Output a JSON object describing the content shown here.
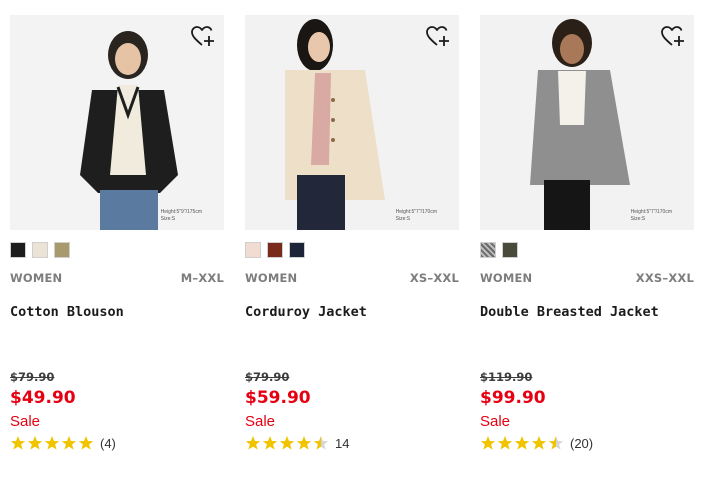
{
  "products": [
    {
      "name": "Cotton Blouson",
      "category": "WOMEN",
      "sizes": "M–XXL",
      "original_price": "$79.90",
      "sale_price": "$49.90",
      "flag": "Sale",
      "rating": 5,
      "review_count": "(4)",
      "model_note_1": "Height:5\"9\"/175cm",
      "model_note_2": "Size:S",
      "swatches": [
        "#1c1c1c",
        "#ebe4d6",
        "#a89a6c"
      ]
    },
    {
      "name": "Corduroy Jacket",
      "category": "WOMEN",
      "sizes": "XS–XXL",
      "original_price": "$79.90",
      "sale_price": "$59.90",
      "flag": "Sale",
      "rating": 4.5,
      "review_count": "14",
      "model_note_1": "Height:5\"7\"/170cm",
      "model_note_2": "Size:S",
      "swatches": [
        "#f0dcd0",
        "#7a2a1a",
        "#1e2438"
      ]
    },
    {
      "name": "Double Breasted Jacket",
      "category": "WOMEN",
      "sizes": "XXS–XXL",
      "original_price": "$119.90",
      "sale_price": "$99.90",
      "flag": "Sale",
      "rating": 4.5,
      "review_count": "(20)",
      "model_note_1": "Height:5\"7\"/170cm",
      "model_note_2": "Size:S",
      "swatches": [
        "#8a8a8a",
        "#4a4a3a"
      ]
    }
  ],
  "colors": {
    "sale_red": "#e60012",
    "star_gold": "#f1c400",
    "star_empty": "#d5d5d5"
  },
  "icons": {
    "wishlist": "heart-plus-icon",
    "star": "star-icon"
  }
}
